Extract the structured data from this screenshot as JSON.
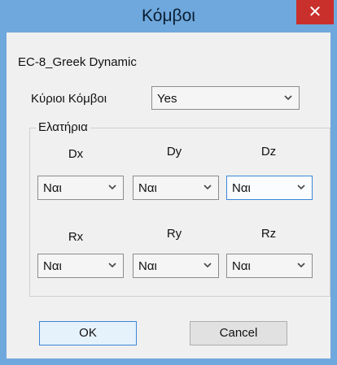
{
  "window": {
    "title": "Κόμβοι",
    "close_glyph": "✕"
  },
  "profile": "EC-8_Greek Dynamic",
  "main_nodes": {
    "label": "Κύριοι Κόμβοι",
    "value": "Yes"
  },
  "springs": {
    "group_label": "Ελατήρια",
    "translations": [
      {
        "label": "Dx",
        "value": "Ναι"
      },
      {
        "label": "Dy",
        "value": "Ναι"
      },
      {
        "label": "Dz",
        "value": "Ναι"
      }
    ],
    "rotations": [
      {
        "label": "Rx",
        "value": "Ναι"
      },
      {
        "label": "Ry",
        "value": "Ναι"
      },
      {
        "label": "Rz",
        "value": "Ναι"
      }
    ]
  },
  "buttons": {
    "ok": "OK",
    "cancel": "Cancel"
  },
  "colors": {
    "titlebar": "#6fa8dc",
    "close": "#c9302c",
    "client": "#f0f0f0",
    "focus_border": "#3b86d6"
  }
}
